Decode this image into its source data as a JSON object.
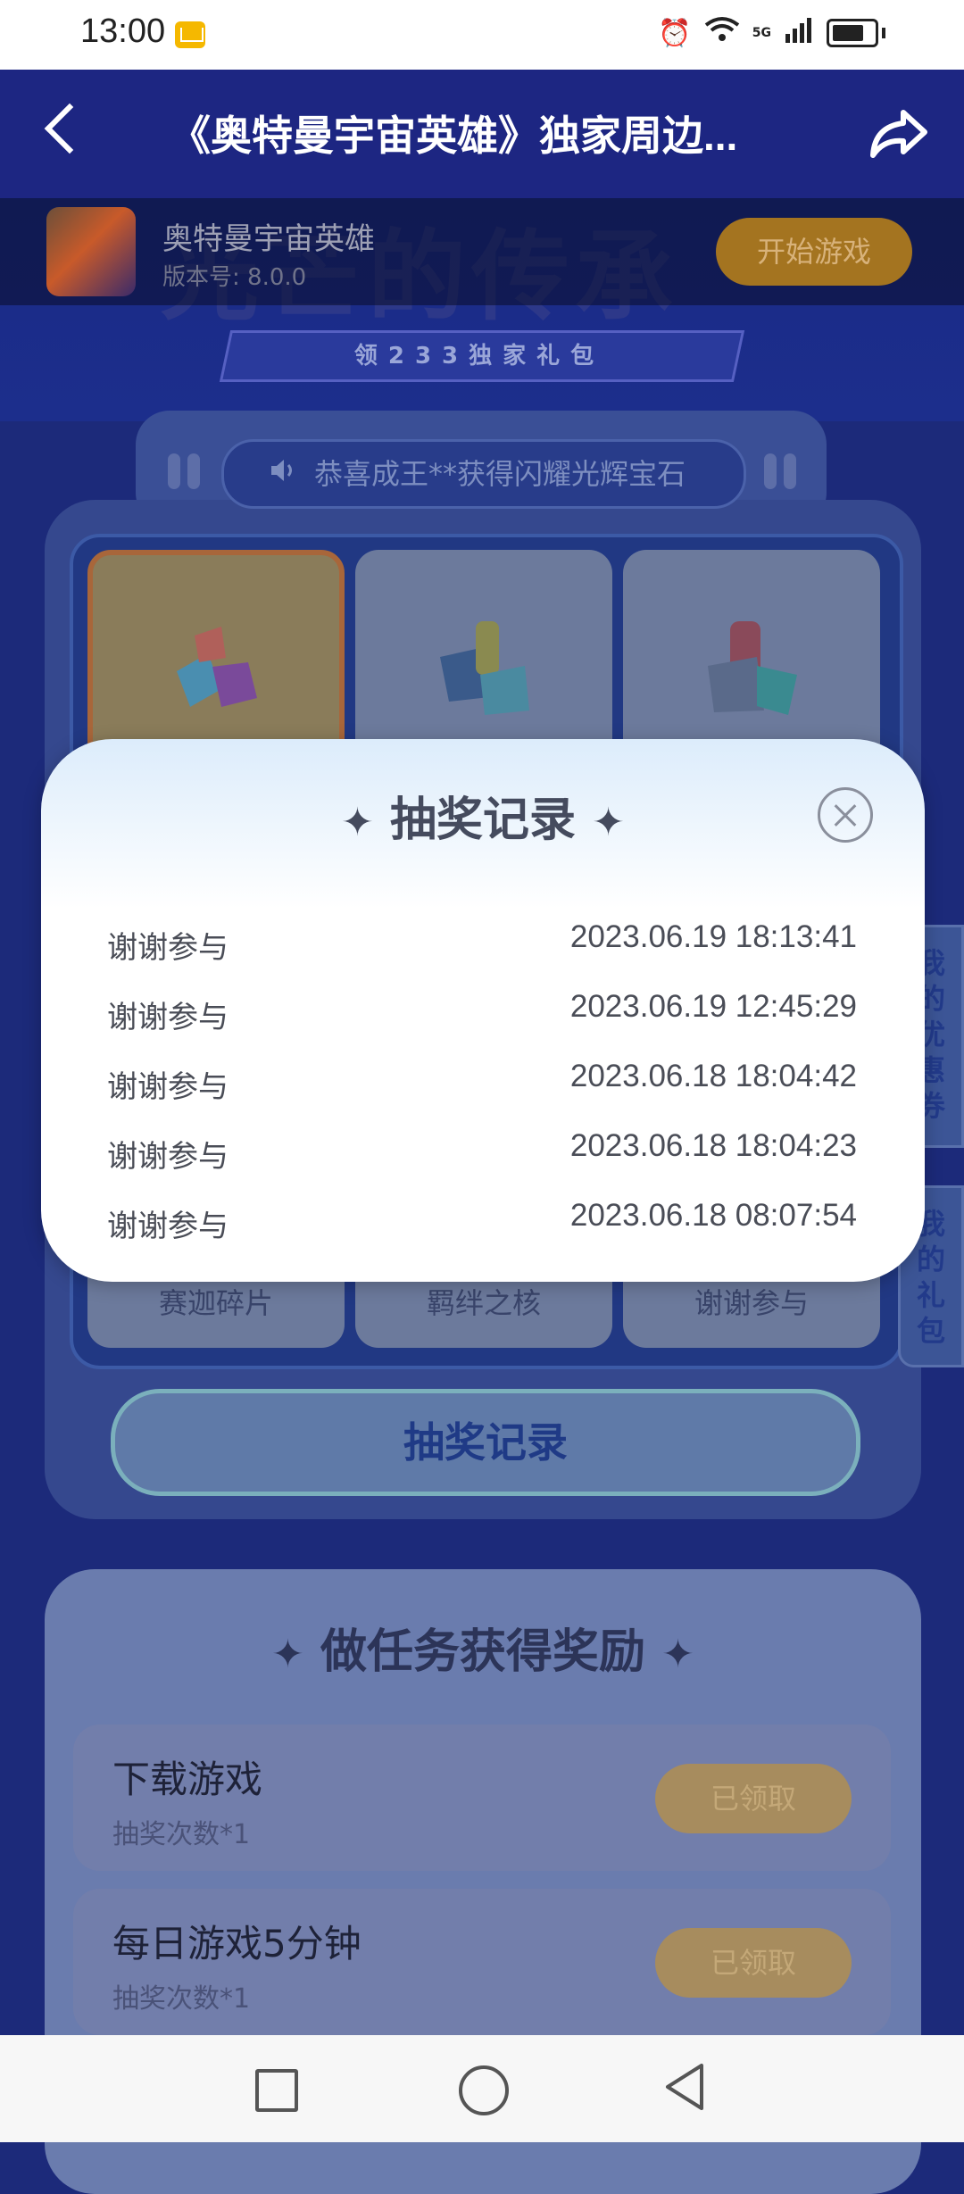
{
  "status_bar": {
    "time": "13:00",
    "network": "5G"
  },
  "header": {
    "title": "《奥特曼宇宙英雄》独家周边..."
  },
  "banner": {
    "title": "光芒的传承",
    "subtitle": "领233独家礼包"
  },
  "app": {
    "name": "奥特曼宇宙英雄",
    "version": "版本号: 8.0.0",
    "start_label": "开始游戏"
  },
  "notice": {
    "text": "恭喜成王**获得闪耀光辉宝石"
  },
  "prizes": {
    "bottom_labels": [
      "赛迦碎片",
      "羁绊之核",
      "谢谢参与"
    ]
  },
  "records_button": "抽奖记录",
  "side_tabs": {
    "coupons": "我的优惠券",
    "gifts": "我的礼包"
  },
  "tasks": {
    "title": "做任务获得奖励",
    "items": [
      {
        "name": "下载游戏",
        "reward": "抽奖次数*1",
        "button": "已领取"
      },
      {
        "name": "每日游戏5分钟",
        "reward": "抽奖次数*1",
        "button": "已领取"
      }
    ]
  },
  "modal": {
    "title": "抽奖记录",
    "records": [
      {
        "prize": "谢谢参与",
        "time": "2023.06.19 18:13:41"
      },
      {
        "prize": "谢谢参与",
        "time": "2023.06.19 12:45:29"
      },
      {
        "prize": "谢谢参与",
        "time": "2023.06.18 18:04:42"
      },
      {
        "prize": "谢谢参与",
        "time": "2023.06.18 18:04:23"
      },
      {
        "prize": "谢谢参与",
        "time": "2023.06.18 08:07:54"
      }
    ]
  }
}
